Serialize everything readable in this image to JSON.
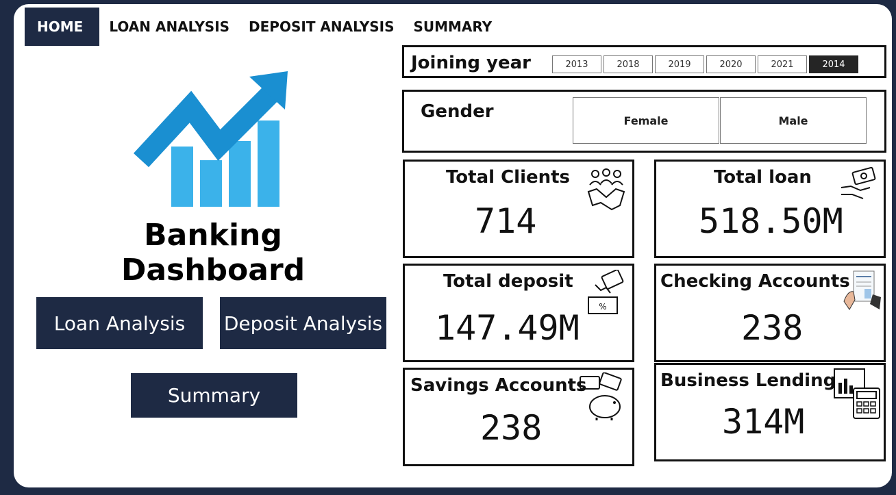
{
  "nav": {
    "tabs": [
      "HOME",
      "LOAN ANALYSIS",
      "DEPOSIT ANALYSIS",
      "SUMMARY"
    ]
  },
  "hero": {
    "title": "Banking Dashboard",
    "buttons": {
      "loan": "Loan Analysis",
      "deposit": "Deposit Analysis",
      "summary": "Summary"
    }
  },
  "filters": {
    "joining_year": {
      "label": "Joining year",
      "options": [
        "2013",
        "2018",
        "2019",
        "2020",
        "2021",
        "2014"
      ],
      "selected": "2014"
    },
    "gender": {
      "label": "Gender",
      "options": [
        "Female",
        "Male"
      ]
    }
  },
  "cards": {
    "total_clients": {
      "title": "Total Clients",
      "value": "714"
    },
    "total_loan": {
      "title": "Total loan",
      "value": "518.50M"
    },
    "total_deposit": {
      "title": "Total deposit",
      "value": "147.49M"
    },
    "checking_accounts": {
      "title": "Checking Accounts",
      "value": "238"
    },
    "savings_accounts": {
      "title": "Savings Accounts",
      "value": "238"
    },
    "business_lending": {
      "title": "Business Lending",
      "value": "314M"
    }
  },
  "colors": {
    "navy": "#1e2a44",
    "arrow_blue": "#1a8fd1",
    "bar_blue": "#3bb2ea"
  }
}
